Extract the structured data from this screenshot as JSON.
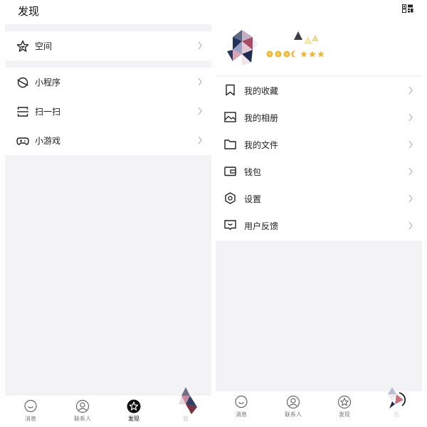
{
  "discover": {
    "title": "发现",
    "sections": [
      {
        "items": [
          {
            "label": "空间",
            "icon": "star-icon"
          }
        ]
      },
      {
        "items": [
          {
            "label": "小程序",
            "icon": "mini-program-icon"
          },
          {
            "label": "扫一扫",
            "icon": "scan-icon"
          },
          {
            "label": "小游戏",
            "icon": "gamepad-icon"
          }
        ]
      }
    ]
  },
  "profile": {
    "level_icons": "star-sun-moon-level-icons",
    "menu": [
      {
        "label": "我的收藏",
        "icon": "bookmark-icon"
      },
      {
        "label": "我的相册",
        "icon": "photo-album-icon"
      },
      {
        "label": "我的文件",
        "icon": "folder-icon"
      },
      {
        "label": "钱包",
        "icon": "wallet-icon"
      },
      {
        "label": "设置",
        "icon": "settings-icon"
      },
      {
        "label": "用户反馈",
        "icon": "feedback-icon"
      }
    ]
  },
  "tabbar_left": [
    {
      "label": "消息",
      "icon": "chat-bubble-icon",
      "active": false
    },
    {
      "label": "联系人",
      "icon": "contacts-icon",
      "active": false
    },
    {
      "label": "发现",
      "icon": "discover-star-icon",
      "active": true
    },
    {
      "label": "我",
      "icon": "avatar-tab-icon",
      "active": false
    }
  ],
  "tabbar_right": [
    {
      "label": "消息",
      "icon": "chat-bubble-icon",
      "active": false
    },
    {
      "label": "联系人",
      "icon": "contacts-icon",
      "active": false
    },
    {
      "label": "发现",
      "icon": "discover-star-icon",
      "active": false
    },
    {
      "label": "我",
      "icon": "avatar-tab-icon",
      "active": true
    }
  ],
  "colors": {
    "background": "#ffffff",
    "gap": "#f3f3f5",
    "text": "#222222",
    "secondary_text": "#777777",
    "chevron": "#b8b8b8",
    "active_tab": "#111111",
    "star_gold": "#f2b630"
  }
}
